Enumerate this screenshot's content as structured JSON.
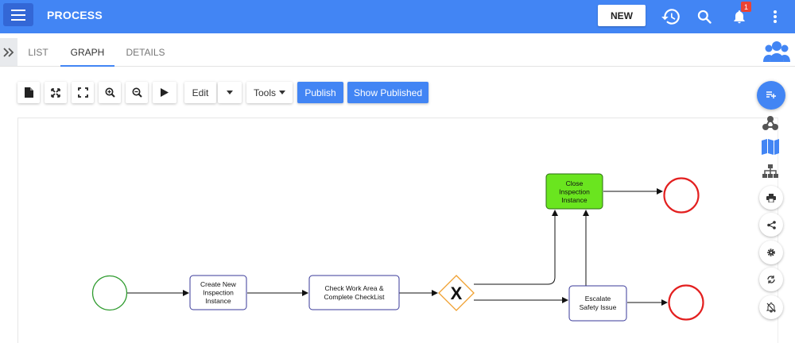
{
  "header": {
    "title": "PROCESS",
    "new_label": "NEW",
    "notification_count": "1",
    "icons": [
      "menu-icon",
      "history-icon",
      "search-icon",
      "bell-icon",
      "more-vert-icon"
    ],
    "color": "#4285f4"
  },
  "tabs": [
    {
      "label": "LIST",
      "active": false
    },
    {
      "label": "GRAPH",
      "active": true
    },
    {
      "label": "DETAILS",
      "active": false
    }
  ],
  "toolbar": {
    "icons": [
      "new-file-icon",
      "fit-to-screen-icon",
      "fullscreen-icon",
      "zoom-in-icon",
      "zoom-out-icon",
      "play-icon"
    ],
    "edit_label": "Edit",
    "tools_label": "Tools",
    "publish_label": "Publish",
    "show_published_label": "Show Published"
  },
  "diagram": {
    "nodes": {
      "create": {
        "lines": [
          "Create New",
          "Inspection",
          "Instance"
        ]
      },
      "check": {
        "lines": [
          "Check Work Area &",
          "Complete CheckList"
        ]
      },
      "gateway": {
        "label": "X"
      },
      "close": {
        "lines": [
          "Close",
          "Inspection",
          "Instance"
        ]
      },
      "escalate": {
        "lines": [
          "Escalate",
          "Safety Issue"
        ]
      }
    },
    "colors": {
      "start_event": "#2e9b2e",
      "end_event": "#e32020",
      "task_border": "#3a3a9a",
      "highlight_task": "#6ae51f",
      "gateway": "#f0a030"
    }
  },
  "right_rail": {
    "icons": [
      "sidebar-toggle-icon",
      "graph-nodes-icon",
      "map-icon",
      "hierarchy-icon",
      "print-icon",
      "share-icon",
      "settings-icon",
      "refresh-icon",
      "notifications-off-icon"
    ]
  }
}
